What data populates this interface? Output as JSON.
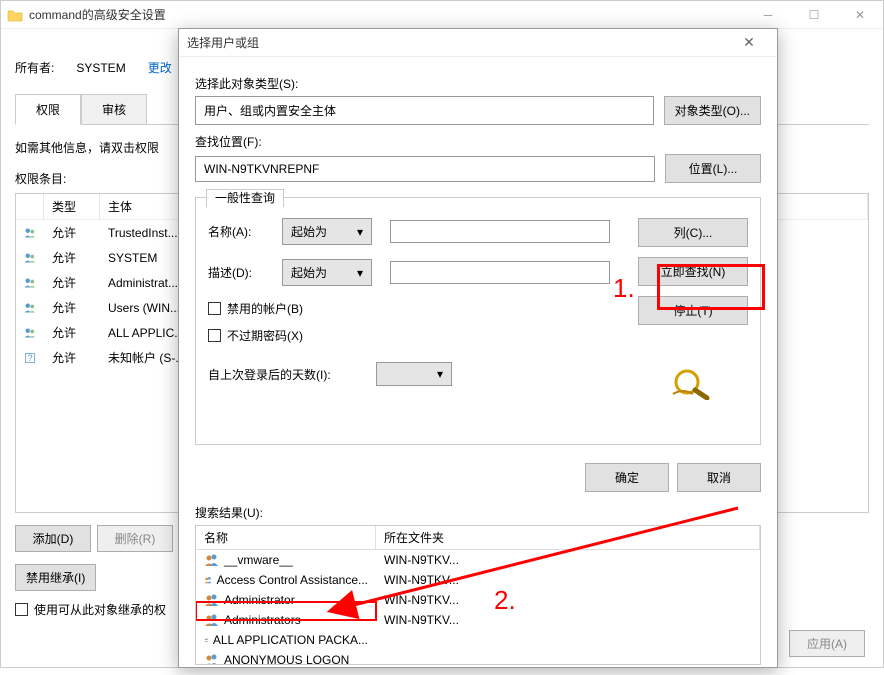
{
  "outer_window": {
    "title": "command的高级安全设置"
  },
  "owner": {
    "label": "所有者:",
    "value": "SYSTEM",
    "change": "更改"
  },
  "tabs": {
    "perm": "权限",
    "audit": "审核"
  },
  "hint": "如需其他信息，请双击权限",
  "entries_label": "权限条目:",
  "header": {
    "type": "类型",
    "principal": "主体"
  },
  "perm_rows": [
    {
      "type": "允许",
      "principal": "TrustedInst..."
    },
    {
      "type": "允许",
      "principal": "SYSTEM"
    },
    {
      "type": "允许",
      "principal": "Administrat..."
    },
    {
      "type": "允许",
      "principal": "Users (WIN..."
    },
    {
      "type": "允许",
      "principal": "ALL APPLIC..."
    },
    {
      "type": "允许",
      "principal": "未知帐户 (S-..."
    }
  ],
  "outer_buttons": {
    "add": "添加(D)",
    "remove": "删除(R)",
    "disable_inherit": "禁用继承(I)",
    "inherit_check": "使用可从此对象继承的权"
  },
  "bottom": {
    "apply": "应用(A)"
  },
  "inner": {
    "title": "选择用户或组",
    "object_type_label": "选择此对象类型(S):",
    "object_type_value": "用户、组或内置安全主体",
    "object_type_btn": "对象类型(O)...",
    "location_label": "查找位置(F):",
    "location_value": "WIN-N9TKVNREPNF",
    "location_btn": "位置(L)...",
    "query_tab": "一般性查询",
    "name_label": "名称(A):",
    "desc_label": "描述(D):",
    "starts_with": "起始为",
    "disabled_accounts": "禁用的帐户(B)",
    "no_expire_pwd": "不过期密码(X)",
    "days_since_logon": "自上次登录后的天数(I):",
    "columns_btn": "列(C)...",
    "find_now_btn": "立即查找(N)",
    "stop_btn": "停止(T)",
    "ok": "确定",
    "cancel": "取消",
    "results_label": "搜索结果(U):",
    "res_header_name": "名称",
    "res_header_folder": "所在文件夹",
    "results": [
      {
        "name": "__vmware__",
        "folder": "WIN-N9TKV..."
      },
      {
        "name": "Access Control Assistance...",
        "folder": "WIN-N9TKV..."
      },
      {
        "name": "Administrator",
        "folder": "WIN-N9TKV..."
      },
      {
        "name": "Administrators",
        "folder": "WIN-N9TKV..."
      },
      {
        "name": "ALL APPLICATION PACKA...",
        "folder": ""
      },
      {
        "name": "ANONYMOUS LOGON",
        "folder": ""
      }
    ]
  },
  "annotations": {
    "one": "1.",
    "two": "2."
  }
}
